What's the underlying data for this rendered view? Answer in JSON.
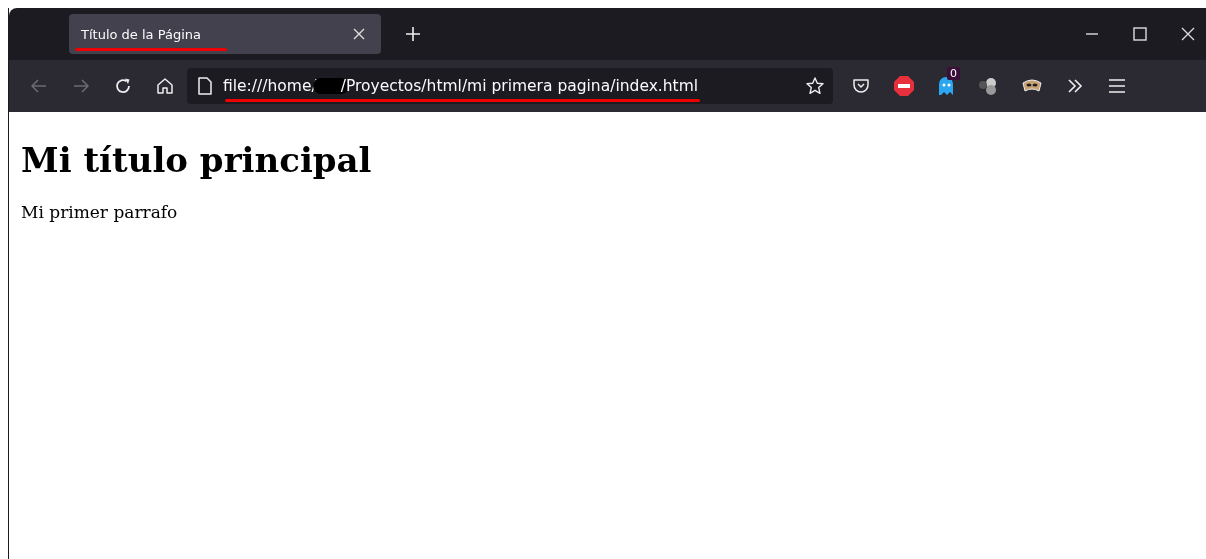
{
  "tabs": [
    {
      "title": "Título de la Página",
      "selected": true,
      "underlined": true
    }
  ],
  "toolbar": {
    "url_start": "file:///home/",
    "url_redacted": true,
    "url_end": "/Proyectos/html/mi primera pagina/index.html",
    "url_underlined": true,
    "back_disabled": true,
    "forward_disabled": true,
    "extension_badge": "0"
  },
  "page": {
    "heading": "Mi título principal",
    "paragraph": "Mi primer parrafo"
  }
}
